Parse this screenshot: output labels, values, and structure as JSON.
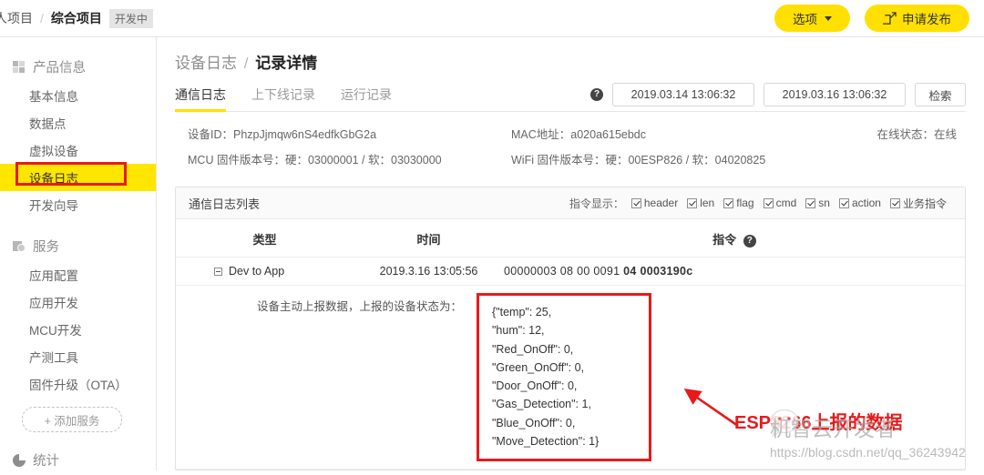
{
  "topbar": {
    "breadcrumb_root": "人项目",
    "breadcrumb_sep": "/",
    "breadcrumb_current": "综合项目",
    "status_tag": "开发中",
    "options_button": "选项",
    "publish_button": "申请发布"
  },
  "sidebar": {
    "sections": [
      {
        "title": "产品信息",
        "icon": "grid-icon",
        "items": [
          {
            "label": "基本信息",
            "active": false
          },
          {
            "label": "数据点",
            "active": false
          },
          {
            "label": "虚拟设备",
            "active": false
          },
          {
            "label": "设备日志",
            "active": true
          },
          {
            "label": "开发向导",
            "active": false
          }
        ]
      },
      {
        "title": "服务",
        "icon": "gear-icon",
        "items": [
          {
            "label": "应用配置",
            "active": false
          },
          {
            "label": "应用开发",
            "active": false
          },
          {
            "label": "MCU开发",
            "active": false
          },
          {
            "label": "产测工具",
            "active": false
          },
          {
            "label": "固件升级（OTA）",
            "active": false
          }
        ]
      }
    ],
    "add_service_button": "+ 添加服务",
    "stats_section": {
      "title": "统计",
      "icon": "pie-chart-icon"
    }
  },
  "main": {
    "title_parent": "设备日志",
    "title_sep": "/",
    "title_current": "记录详情",
    "tabs": [
      {
        "label": "通信日志",
        "active": true
      },
      {
        "label": "上下线记录",
        "active": false
      },
      {
        "label": "运行记录",
        "active": false
      }
    ],
    "help_icon": "?",
    "date_from": "2019.03.14 13:06:32",
    "date_to": "2019.03.16 13:06:32",
    "search_button": "检索",
    "device_info": {
      "device_id_label": "设备ID：",
      "device_id_value": "PhzpJjmqw6nS4edfkGbG2a",
      "mac_label": "MAC地址：",
      "mac_value": "a020a615ebdc",
      "online_label": "在线状态：",
      "online_value": "在线",
      "mcu_label": "MCU 固件版本号：",
      "mcu_value": "硬：03000001 / 软：03030000",
      "wifi_label": "WiFi 固件版本号：",
      "wifi_value": "硬：00ESP826 / 软：04020825"
    },
    "panel": {
      "title": "通信日志列表",
      "cmd_display_label": "指令显示：",
      "checkboxes": [
        {
          "label": "header",
          "checked": true
        },
        {
          "label": "len",
          "checked": true
        },
        {
          "label": "flag",
          "checked": true
        },
        {
          "label": "cmd",
          "checked": true
        },
        {
          "label": "sn",
          "checked": true
        },
        {
          "label": "action",
          "checked": true
        },
        {
          "label": "业务指令",
          "checked": true
        }
      ],
      "columns": {
        "type": "类型",
        "time": "时间",
        "command": "指令"
      },
      "row": {
        "type": "Dev to App",
        "time": "2019.3.16 13:05:56",
        "cmd_plain": "00000003 08 00 0091",
        "cmd_bold_1": "04",
        "cmd_bold_2": "0003190c"
      },
      "detail": {
        "label": "设备主动上报数据，上报的设备状态为：",
        "json": "{\"temp\": 25,\n\"hum\": 12,\n\"Red_OnOff\": 0,\n\"Green_OnOff\": 0,\n\"Door_OnOff\": 0,\n\"Gas_Detection\": 1,\n\"Blue_OnOff\": 0,\n\"Move_Detection\": 1}"
      }
    }
  },
  "annotations": {
    "callout_text": "ESP8266上报的数据",
    "callout_color": "#e8191b",
    "watermark_text": "机智云开发者",
    "watermark_url": "https://blog.csdn.net/qq_36243942"
  },
  "colors": {
    "accent_yellow": "#ffe000",
    "highlight_yellow": "#ffe600",
    "annotation_red": "#e8191b"
  }
}
